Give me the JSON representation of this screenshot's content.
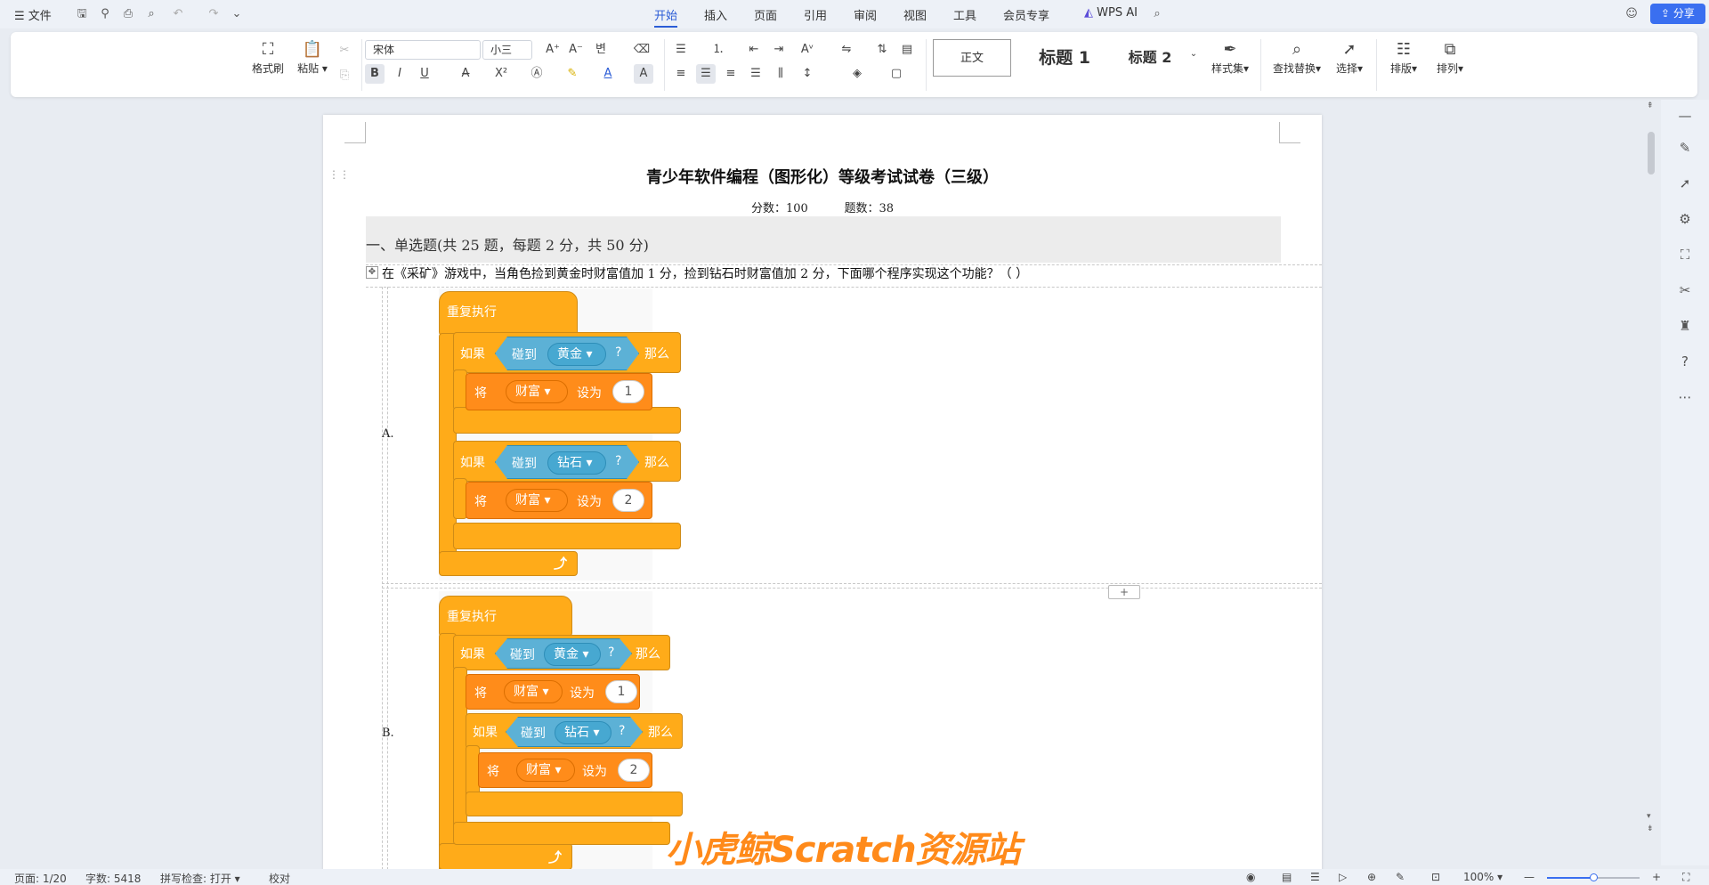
{
  "menubar": {
    "file_label": "文件",
    "tabs": [
      "开始",
      "插入",
      "页面",
      "引用",
      "审阅",
      "视图",
      "工具",
      "会员专享"
    ],
    "active_tab": "开始",
    "wps_ai_label": "WPS AI",
    "share_label": "分享"
  },
  "ribbon": {
    "format_painter": "格式刷",
    "paste": "粘贴",
    "font_name": "宋体",
    "font_size": "小三",
    "style_normal": "正文",
    "style_heading1": "标题 1",
    "style_heading2": "标题 2",
    "style_set": "样式集",
    "find_replace": "查找替换",
    "select": "选择",
    "layout": "排版",
    "arrange": "排列",
    "bold": "B",
    "italic": "I",
    "underline": "U",
    "font_color_glyph": "A",
    "char_shading_glyph": "A",
    "accent_color": "#2b5cd6"
  },
  "document": {
    "title": "青少年软件编程（图形化）等级考试试卷（三级）",
    "score_label": "分数：100",
    "count_label": "题数：38",
    "section_heading": "一、单选题(共 25 题，每题 2 分，共 50 分)",
    "question_1": "在《采矿》游戏中，当角色捡到黄金时财富值加 1 分，捡到钻石时财富值加 2 分，下面哪个程序实现这个功能？（  ）",
    "option_a_label": "A.",
    "option_b_label": "B.",
    "add_row": "+",
    "blocks": {
      "forever": "重复执行",
      "if": "如果",
      "then": "那么",
      "touching": "碰到",
      "question_mark": "?",
      "gold": "黄金",
      "diamond": "钻石",
      "set": "将",
      "variable": "财富",
      "to": "设为",
      "value_1": "1",
      "value_2": "2"
    }
  },
  "watermark": "小虎鲸Scratch资源站",
  "statusbar": {
    "page": "页面: 1/20",
    "word_count": "字数: 5418",
    "spell_check": "拼写检查: 打开",
    "proofread": "校对",
    "zoom": "100%"
  }
}
